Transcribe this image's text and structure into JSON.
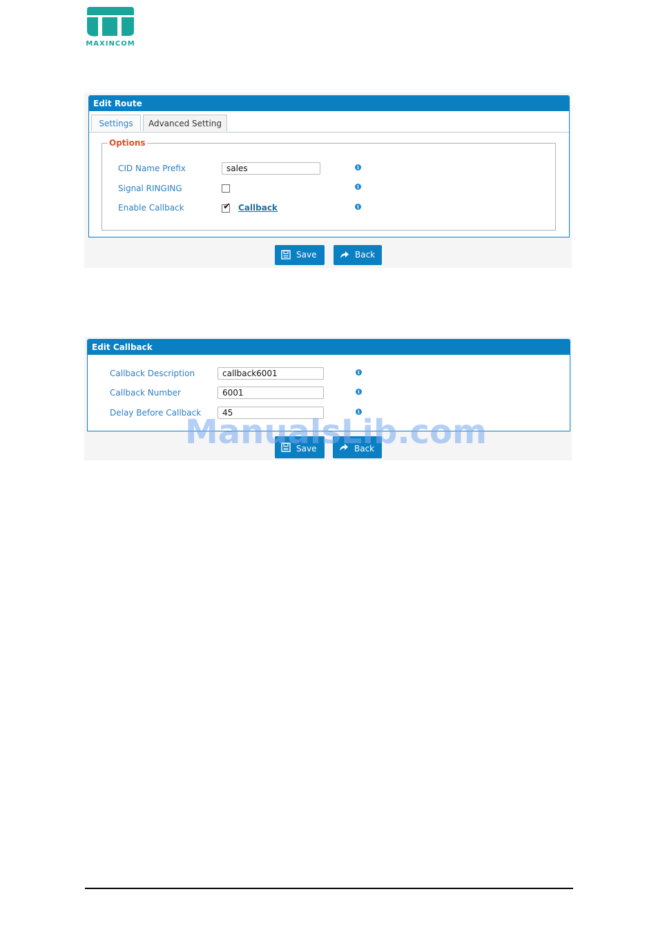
{
  "logo": {
    "text": "MAXINCOM"
  },
  "edit_route": {
    "title": "Edit Route",
    "tabs": [
      {
        "label": "Settings",
        "active": false
      },
      {
        "label": "Advanced Setting",
        "active": true
      }
    ],
    "options_legend": "Options",
    "fields": {
      "cid_name_prefix": {
        "label": "CID Name Prefix",
        "value": "sales"
      },
      "signal_ringing": {
        "label": "Signal RINGING",
        "checked": false
      },
      "enable_callback": {
        "label": "Enable Callback",
        "checked": true,
        "link": "Callback"
      }
    },
    "save_label": "Save",
    "back_label": "Back"
  },
  "edit_callback": {
    "title": "Edit Callback",
    "fields": {
      "description": {
        "label": "Callback Description",
        "value": "callback6001"
      },
      "number": {
        "label": "Callback Number",
        "value": "6001"
      },
      "delay": {
        "label": "Delay Before Callback",
        "value": "45"
      }
    },
    "save_label": "Save",
    "back_label": "Back"
  },
  "watermark": "ManualsLib.com",
  "colors": {
    "accent": "#0a7fc2",
    "label": "#2a7fc4",
    "legend": "#d9502b",
    "logo": "#1aa59c"
  }
}
